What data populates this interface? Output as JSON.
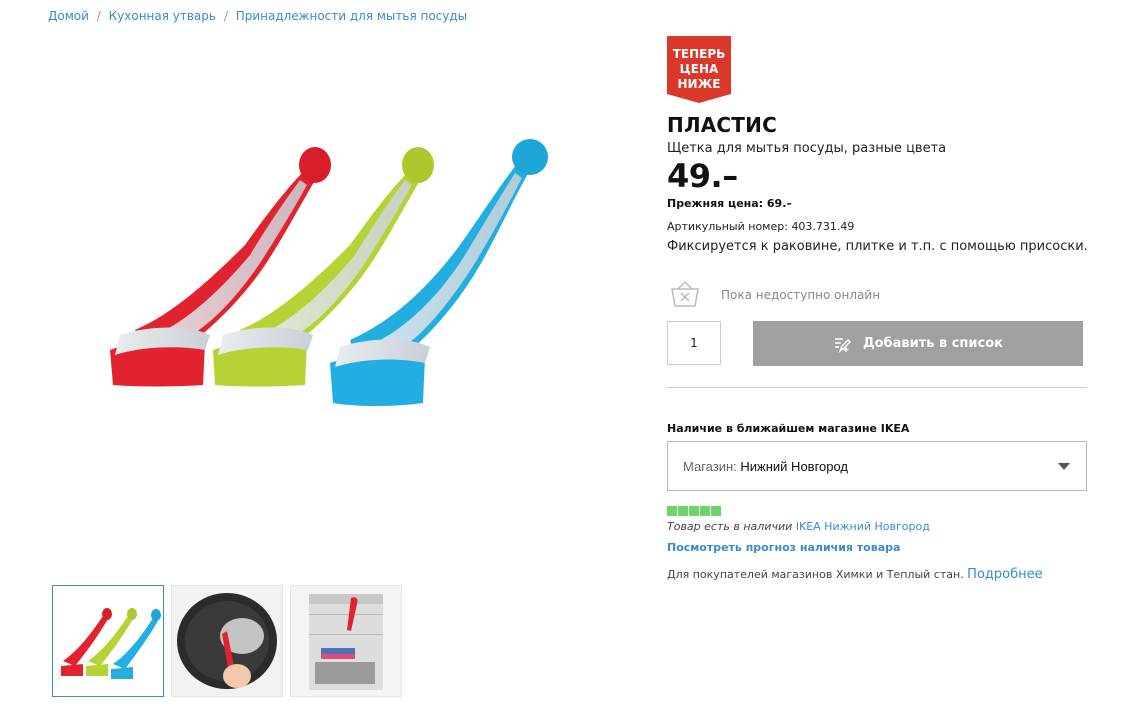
{
  "breadcrumb": {
    "items": [
      "Домой",
      "Кухонная утварь",
      "Принадлежности для мытья посуды"
    ],
    "separator": "/"
  },
  "badge": {
    "lines": [
      "ТЕПЕРЬ",
      "ЦЕНА",
      "НИЖЕ"
    ],
    "color": "#d9382a"
  },
  "product": {
    "name": "ПЛАСТИС",
    "description": "Щетка для мытья посуды, разные цвета",
    "price": "49.–",
    "old_price": "Прежняя цена: 69.–",
    "article_label": "Артикульный номер:",
    "article_number": "403.731.49",
    "feature": "Фиксируется к раковине, плитке и т.п. с помощью присоски."
  },
  "availability": {
    "online_text": "Пока недоступно онлайн",
    "icon": "basket-unavailable-icon"
  },
  "quantity": {
    "value": "1"
  },
  "add_button": {
    "label": "Добавить в список",
    "icon": "list-add-icon",
    "color": "#a0a0a0"
  },
  "store": {
    "heading": "Наличие в ближайшем магазине IKEA",
    "select_label": "Магазин:",
    "select_value": "Нижний Новгород",
    "stock_text": "Товар есть в наличии",
    "stock_store": "IKEA Нижний Новгород",
    "stock_color": "#6dd46a",
    "forecast_link": "Посмотреть прогноз наличия товара",
    "note": "Для покупателей магазинов Химки и Теплый стан.",
    "note_link": "Подробнее"
  },
  "colors": {
    "link": "#3a8bc8",
    "brush_red": "#e0232f",
    "brush_green": "#b5d334",
    "brush_blue": "#22aee0"
  },
  "thumbnails": [
    {
      "name": "brushes-thumb"
    },
    {
      "name": "pan-washing-thumb"
    },
    {
      "name": "sink-thumb"
    }
  ]
}
